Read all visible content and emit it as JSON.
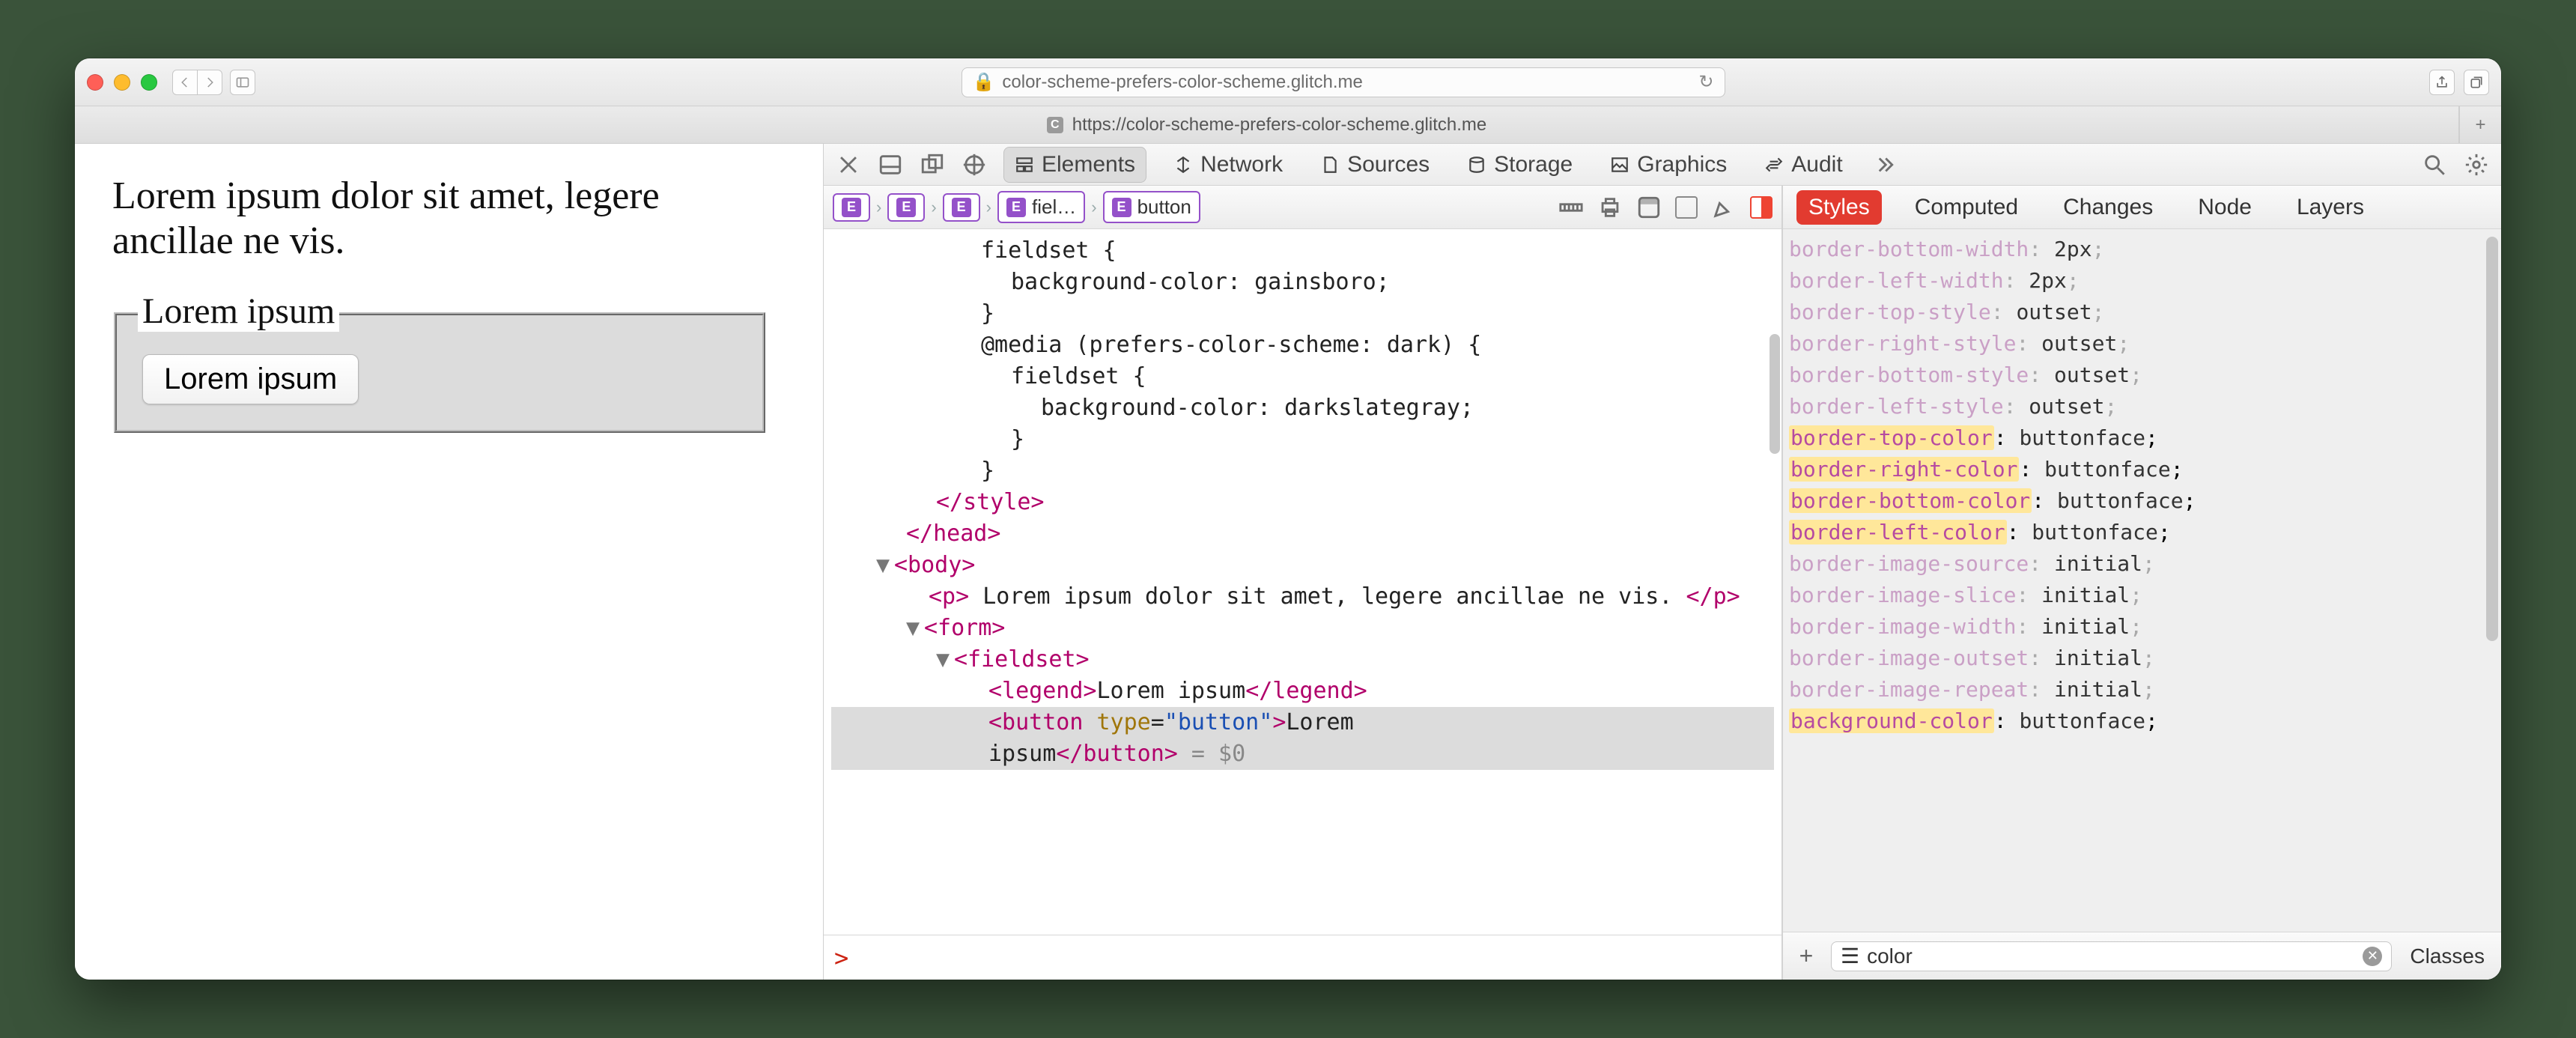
{
  "browser": {
    "address": "color-scheme-prefers-color-scheme.glitch.me",
    "tab_label": "https://color-scheme-prefers-color-scheme.glitch.me",
    "tab_fav_letter": "C",
    "new_tab_plus": "+"
  },
  "page": {
    "paragraph": "Lorem ipsum dolor sit amet, legere ancillae ne vis.",
    "legend": "Lorem ipsum",
    "button": "Lorem ipsum"
  },
  "devtools": {
    "tabs": {
      "elements": "Elements",
      "network": "Network",
      "sources": "Sources",
      "storage": "Storage",
      "graphics": "Graphics",
      "audit": "Audit"
    },
    "crumbs": {
      "e": "E",
      "fiel": "fiel…",
      "button": "button"
    },
    "dom": {
      "l1": "fieldset {",
      "l2": "background-color: gainsboro;",
      "l3": "}",
      "l4": "@media (prefers-color-scheme: dark) {",
      "l5": "fieldset {",
      "l6": "background-color: darkslategray;",
      "l7": "}",
      "l8": "}",
      "styleclose": "</style>",
      "headclose": "</head>",
      "bodyopen": "<body>",
      "p_open": "<p>",
      "p_text": " Lorem ipsum dolor sit amet, legere ancillae ne vis. ",
      "p_close": "</p>",
      "form": "<form>",
      "fieldset": "<fieldset>",
      "legend_open": "<legend>",
      "legend_text": "Lorem ipsum",
      "legend_close": "</legend>",
      "btn_open": "<button",
      "btn_attr": " type",
      "btn_eq": "=",
      "btn_val": "\"button\"",
      "btn_gt": ">",
      "btn_text1": "Lorem",
      "btn_text2": "ipsum",
      "btn_close": "</button>",
      "dollar": " = $0"
    },
    "console_prompt": ">",
    "side": {
      "tabs": {
        "styles": "Styles",
        "computed": "Computed",
        "changes": "Changes",
        "node": "Node",
        "layers": "Layers"
      },
      "rules": [
        {
          "p": "border-bottom-width",
          "v": "2px",
          "dim": true,
          "hl": false
        },
        {
          "p": "border-left-width",
          "v": "2px",
          "dim": true,
          "hl": false
        },
        {
          "p": "border-top-style",
          "v": "outset",
          "dim": true,
          "hl": false
        },
        {
          "p": "border-right-style",
          "v": "outset",
          "dim": true,
          "hl": false
        },
        {
          "p": "border-bottom-style",
          "v": "outset",
          "dim": true,
          "hl": false
        },
        {
          "p": "border-left-style",
          "v": "outset",
          "dim": true,
          "hl": false
        },
        {
          "p": "border-top-color",
          "v": "buttonface",
          "dim": false,
          "hl": true
        },
        {
          "p": "border-right-color",
          "v": "buttonface",
          "dim": false,
          "hl": true
        },
        {
          "p": "border-bottom-color",
          "v": "buttonface",
          "dim": false,
          "hl": true
        },
        {
          "p": "border-left-color",
          "v": "buttonface",
          "dim": false,
          "hl": true
        },
        {
          "p": "border-image-source",
          "v": "initial",
          "dim": true,
          "hl": false
        },
        {
          "p": "border-image-slice",
          "v": "initial",
          "dim": true,
          "hl": false
        },
        {
          "p": "border-image-width",
          "v": "initial",
          "dim": true,
          "hl": false
        },
        {
          "p": "border-image-outset",
          "v": "initial",
          "dim": true,
          "hl": false
        },
        {
          "p": "border-image-repeat",
          "v": "initial",
          "dim": true,
          "hl": false
        },
        {
          "p": "background-color",
          "v": "buttonface",
          "dim": false,
          "hl": true
        }
      ],
      "filter_value": "color",
      "classes": "Classes",
      "plus": "+"
    }
  }
}
